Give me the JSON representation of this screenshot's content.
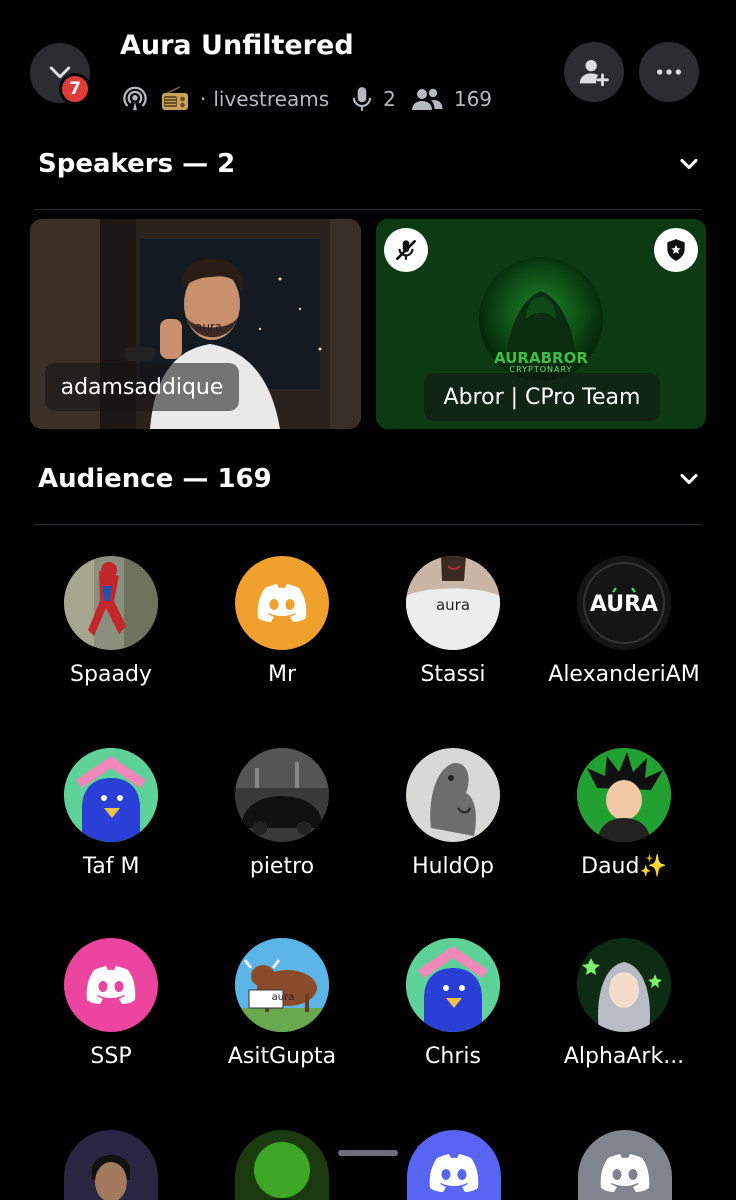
{
  "header": {
    "title": "Aura Unfiltered",
    "notification_count": "7",
    "channel_separator": "·",
    "channel": "livestreams",
    "speaker_count": "2",
    "listener_count": "169"
  },
  "speakers_section": {
    "title": "Speakers — 2"
  },
  "speakers": [
    {
      "name": "adamsaddique",
      "shirt_text": "aura"
    },
    {
      "name": "Abror | CPro Team",
      "logo_text": "AURABROR",
      "logo_subtext": "CRYPTONARY"
    }
  ],
  "audience_section": {
    "title": "Audience — 169"
  },
  "audience": [
    {
      "name": "Spaady",
      "avatar": "spiderman-photo"
    },
    {
      "name": "Mr",
      "avatar": "discord-default-orange"
    },
    {
      "name": "Stassi",
      "avatar": "aura-shirt-photo",
      "avatar_text": "aura"
    },
    {
      "name": "AlexanderiAM",
      "avatar": "aura-logo",
      "avatar_text": "AURA"
    },
    {
      "name": "Taf M",
      "avatar": "blue-bird-pink-house"
    },
    {
      "name": "pietro",
      "avatar": "night-car-photo"
    },
    {
      "name": "HuldOp",
      "avatar": "sketch-creature"
    },
    {
      "name": "Daud✨",
      "avatar": "anime-goku"
    },
    {
      "name": "SSP",
      "avatar": "discord-default-pink"
    },
    {
      "name": "AsitGupta",
      "avatar": "bull-aura-sign",
      "avatar_text": "aura"
    },
    {
      "name": "Chris",
      "avatar": "blue-bird-pink-house"
    },
    {
      "name": "AlphaArk...",
      "avatar": "anime-girl-stars"
    }
  ],
  "colors": {
    "background": "#000000",
    "button_bg": "#2b2d31",
    "badge_red": "#e03c3c",
    "discord_orange": "#f0a02c",
    "discord_pink": "#eb459f",
    "discord_blurple": "#5865f2",
    "discord_gray": "#80848e",
    "speaker_green": "#0c3a12"
  }
}
